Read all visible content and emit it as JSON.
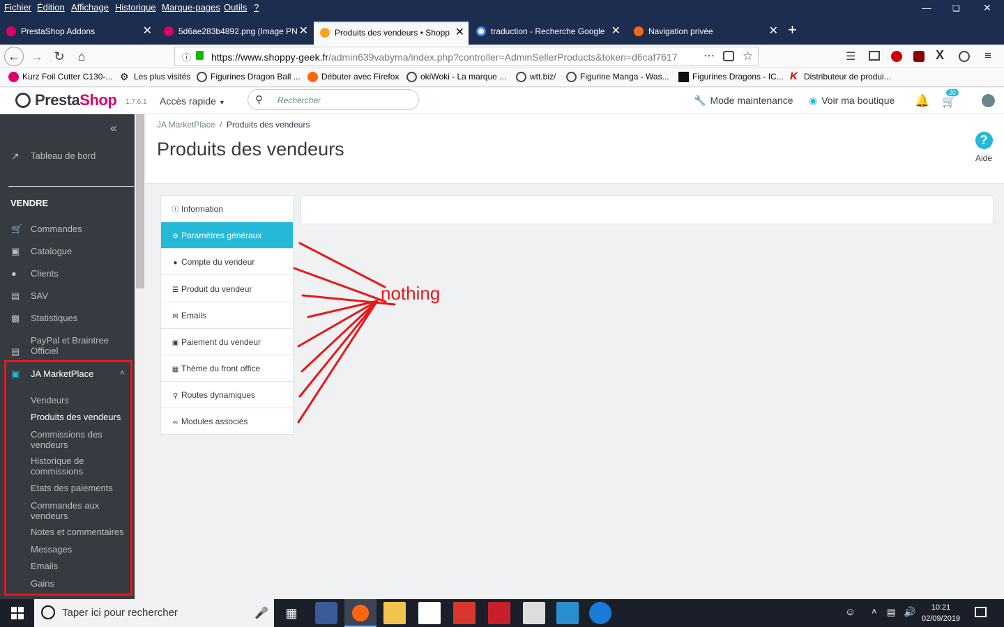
{
  "menu": [
    "Fichier",
    "Édition",
    "Affichage",
    "Historique",
    "Marque-pages",
    "Outils",
    "?"
  ],
  "tabs": [
    {
      "label": "PrestaShop Addons"
    },
    {
      "label": "5d6ae283b4892.png (Image PN"
    },
    {
      "label": "Produits des vendeurs • Shopp"
    },
    {
      "label": "traduction - Recherche Google"
    },
    {
      "label": "Navigation privée"
    }
  ],
  "url": {
    "domain": "https://www.shoppy-geek.fr",
    "path": "/admin639vabyma/index.php?controller=AdminSellerProducts&token=d6caf7617"
  },
  "bookmarks": [
    "Kurz Foil Cutter C130-...",
    "Les plus visités",
    "Figurines Dragon Ball ...",
    "Débuter avec Firefox",
    "okiWoki - La marque ...",
    "wtt.biz/",
    "Figurine Manga - Was...",
    "Figurines Dragons - IC...",
    "Distributeur de produi..."
  ],
  "header": {
    "logo": {
      "a": "Presta",
      "b": "Shop"
    },
    "version": "1.7.6.1",
    "quick_access": "Accès rapide",
    "search_placeholder": "Rechercher",
    "maintenance": "Mode maintenance",
    "view_shop": "Voir ma boutique",
    "cart_badge": "20"
  },
  "sidebar": {
    "dashboard": "Tableau de bord",
    "section": "VENDRE",
    "items": [
      "Commandes",
      "Catalogue",
      "Clients",
      "SAV",
      "Statistiques",
      "PayPal et Braintree Officiel"
    ],
    "module": "JA MarketPlace",
    "sub_items": [
      "Vendeurs",
      "Produits des vendeurs",
      "Commissions des vendeurs",
      "Historique de commissions",
      "Etats des paiements",
      "Commandes aux vendeurs",
      "Notes et commentaires",
      "Messages",
      "Emails",
      "Gains"
    ]
  },
  "breadcrumb": {
    "parent": "JA MarketPlace",
    "current": "Produits des vendeurs"
  },
  "page_title": "Produits des vendeurs",
  "help_label": "Aide",
  "settings_tabs": [
    "Information",
    "Paramètres généraux",
    "Compte du vendeur",
    "Produit du vendeur",
    "Emails",
    "Paiement du vendeur",
    "Thème du front office",
    "Routes dynamiques",
    "Modules associés"
  ],
  "annotation": "nothing",
  "taskbar": {
    "search_placeholder": "Taper ici pour rechercher",
    "time": "10:21",
    "date": "02/09/2019"
  },
  "colors": {
    "accent": "#25b9d7",
    "annotation": "#e8181a",
    "sidebar_bg": "#363a41",
    "firefox_bar": "#1c2d4f"
  }
}
